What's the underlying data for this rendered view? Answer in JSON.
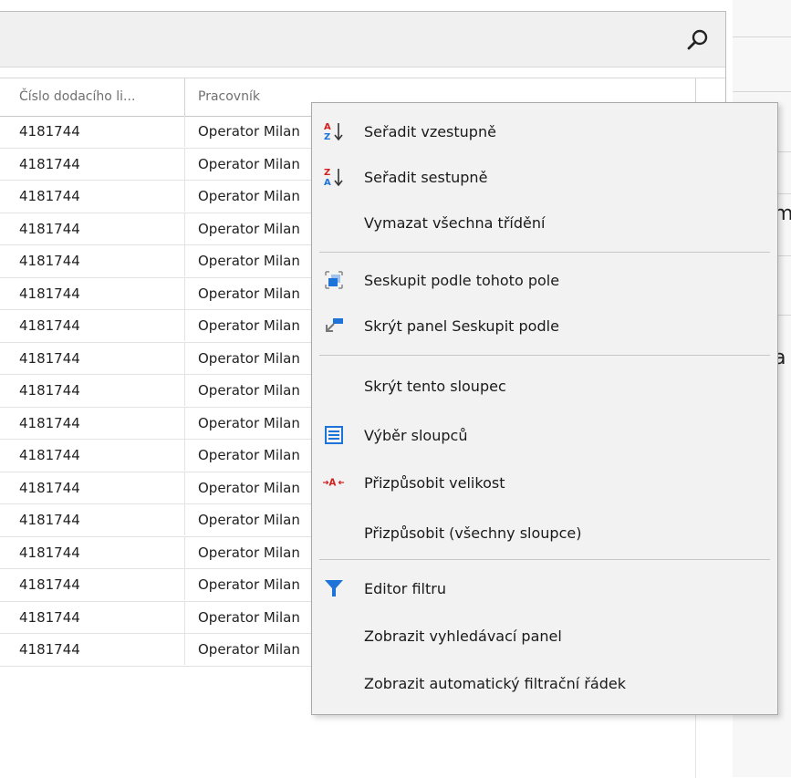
{
  "grid": {
    "columns": [
      "Číslo dodacího li...",
      "Pracovník"
    ],
    "rows": [
      [
        "4181744",
        "Operator Milan"
      ],
      [
        "4181744",
        "Operator Milan"
      ],
      [
        "4181744",
        "Operator Milan"
      ],
      [
        "4181744",
        "Operator Milan"
      ],
      [
        "4181744",
        "Operator Milan"
      ],
      [
        "4181744",
        "Operator Milan"
      ],
      [
        "4181744",
        "Operator Milan"
      ],
      [
        "4181744",
        "Operator Milan"
      ],
      [
        "4181744",
        "Operator Milan"
      ],
      [
        "4181744",
        "Operator Milan"
      ],
      [
        "4181744",
        "Operator Milan"
      ],
      [
        "4181744",
        "Operator Milan"
      ],
      [
        "4181744",
        "Operator Milan"
      ],
      [
        "4181744",
        "Operator Milan"
      ],
      [
        "4181744",
        "Operator Milan"
      ],
      [
        "4181744",
        "Operator Milan"
      ],
      [
        "4181744",
        "Operator Milan"
      ]
    ]
  },
  "toolbar": {
    "search_icon": "search-icon"
  },
  "context_menu": {
    "items": [
      {
        "label": "Seřadit vzestupně",
        "icon": "sort-ascending-icon"
      },
      {
        "label": "Seřadit sestupně",
        "icon": "sort-descending-icon"
      },
      {
        "label": "Vymazat všechna třídění",
        "icon": ""
      },
      {
        "label": "Seskupit podle tohoto pole",
        "icon": "group-by-field-icon"
      },
      {
        "label": "Skrýt panel Seskupit podle",
        "icon": "hide-group-panel-icon"
      },
      {
        "label": "Skrýt tento sloupec",
        "icon": ""
      },
      {
        "label": "Výběr sloupců",
        "icon": "column-chooser-icon"
      },
      {
        "label": "Přizpůsobit velikost",
        "icon": "best-fit-icon"
      },
      {
        "label": "Přizpůsobit (všechny sloupce)",
        "icon": ""
      },
      {
        "label": "Editor filtru",
        "icon": "filter-icon"
      },
      {
        "label": "Zobrazit vyhledávací panel",
        "icon": ""
      },
      {
        "label": "Zobrazit automatický filtrační řádek",
        "icon": ""
      }
    ]
  },
  "right_panel": {
    "fragment_1": "m",
    "fragment_2": "a"
  },
  "colors": {
    "accent_blue": "#1e73d8",
    "sort_red": "#d21f1f",
    "menu_bg": "#f2f2f2"
  }
}
